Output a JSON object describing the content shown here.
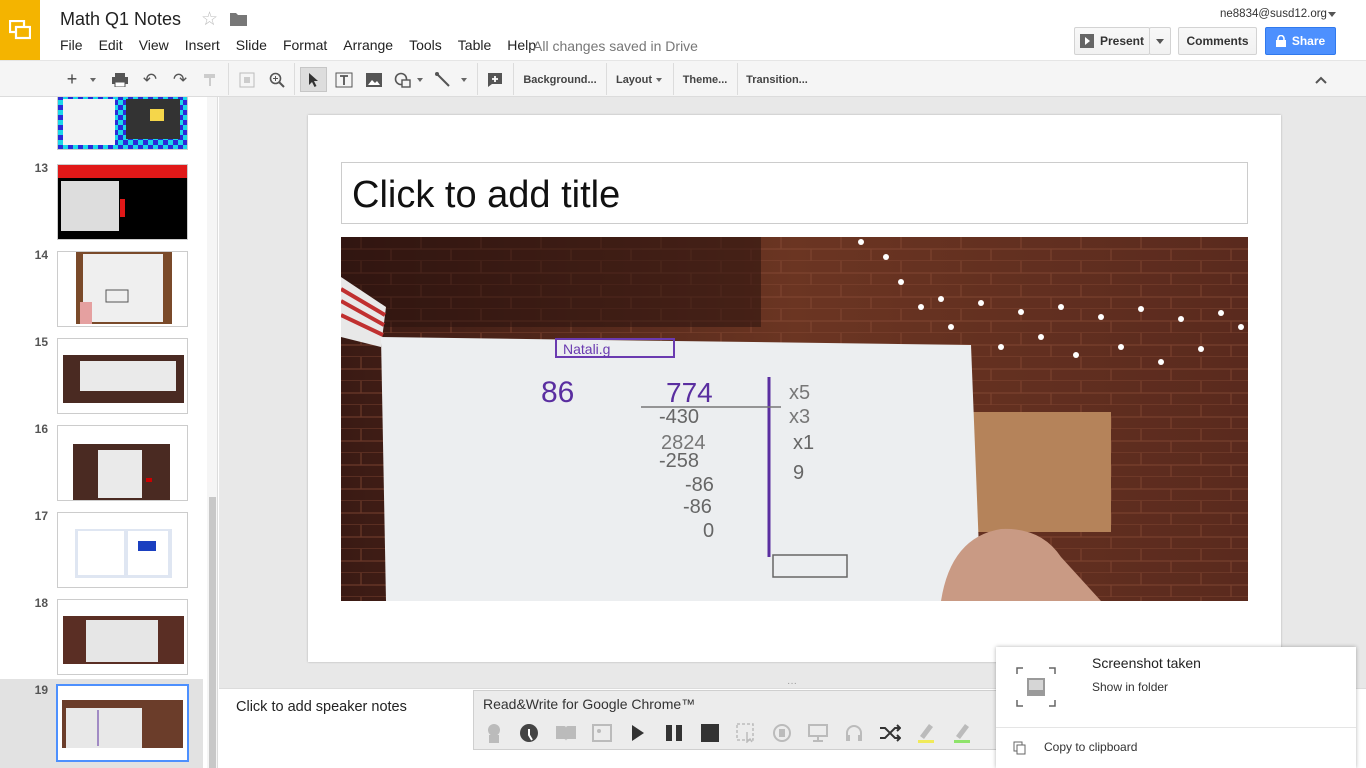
{
  "header": {
    "doc_title": "Math Q1 Notes",
    "saved_status": "All changes saved in Drive",
    "account_email": "ne8834@susd12.org",
    "present_label": "Present",
    "comments_label": "Comments",
    "share_label": "Share"
  },
  "menu": [
    "File",
    "Edit",
    "View",
    "Insert",
    "Slide",
    "Format",
    "Arrange",
    "Tools",
    "Table",
    "Help"
  ],
  "toolbar": {
    "background_label": "Background...",
    "layout_label": "Layout",
    "theme_label": "Theme...",
    "transition_label": "Transition..."
  },
  "filmstrip": {
    "slides": [
      {
        "number": ""
      },
      {
        "number": "13"
      },
      {
        "number": "14"
      },
      {
        "number": "15"
      },
      {
        "number": "16"
      },
      {
        "number": "17"
      },
      {
        "number": "18"
      },
      {
        "number": "19"
      }
    ],
    "selected": "19"
  },
  "slide": {
    "title_placeholder": "Click to add title",
    "photo_sign": "Natali.g",
    "photo_division": {
      "divisor": "86",
      "dividend": "774",
      "steps": [
        "-430",
        "2824",
        "-258",
        "-86",
        "-86",
        "0"
      ],
      "side": [
        "x5",
        "x3",
        "x1",
        "9"
      ]
    }
  },
  "notes": {
    "placeholder": "Click to add speaker notes"
  },
  "readwrite": {
    "title": "Read&Write for Google Chrome™"
  },
  "notification": {
    "title": "Screenshot taken",
    "show_folder": "Show in folder",
    "copy_label": "Copy to clipboard"
  },
  "colors": {
    "accent": "#f4b400",
    "share": "#4d90fe",
    "selection": "#4d90fe"
  }
}
